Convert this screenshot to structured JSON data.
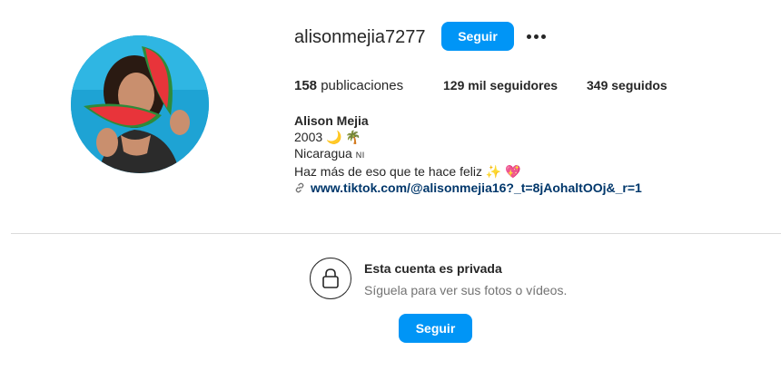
{
  "profile": {
    "username": "alisonmejia7277",
    "follow_label": "Seguir",
    "more_icon": "more-horizontal-icon",
    "avatar_icon": "profile-photo-avatar"
  },
  "stats": {
    "posts_count": "158",
    "posts_label": "publicaciones",
    "followers_count": "129 mil",
    "followers_label": "seguidores",
    "following_count": "349",
    "following_label": "seguidos"
  },
  "bio": {
    "name": "Alison Mejia",
    "line1": "2003 🌙 🌴",
    "line2_text": "Nicaragua",
    "line2_flag": "NI",
    "line3": "Haz más de eso que te hace feliz ✨ 💖",
    "link_text": "www.tiktok.com/@alisonmejia16?_t=8jAohaltOOj&_r=1",
    "link_icon": "link-icon"
  },
  "private": {
    "lock_icon": "lock-icon",
    "title": "Esta cuenta es privada",
    "subtitle": "Síguela para ver sus fotos o vídeos.",
    "follow_label": "Seguir"
  },
  "colors": {
    "accent": "#0095f6",
    "link": "#00376b",
    "text": "#262626",
    "muted": "#737373",
    "divider": "#dbdbdb"
  }
}
